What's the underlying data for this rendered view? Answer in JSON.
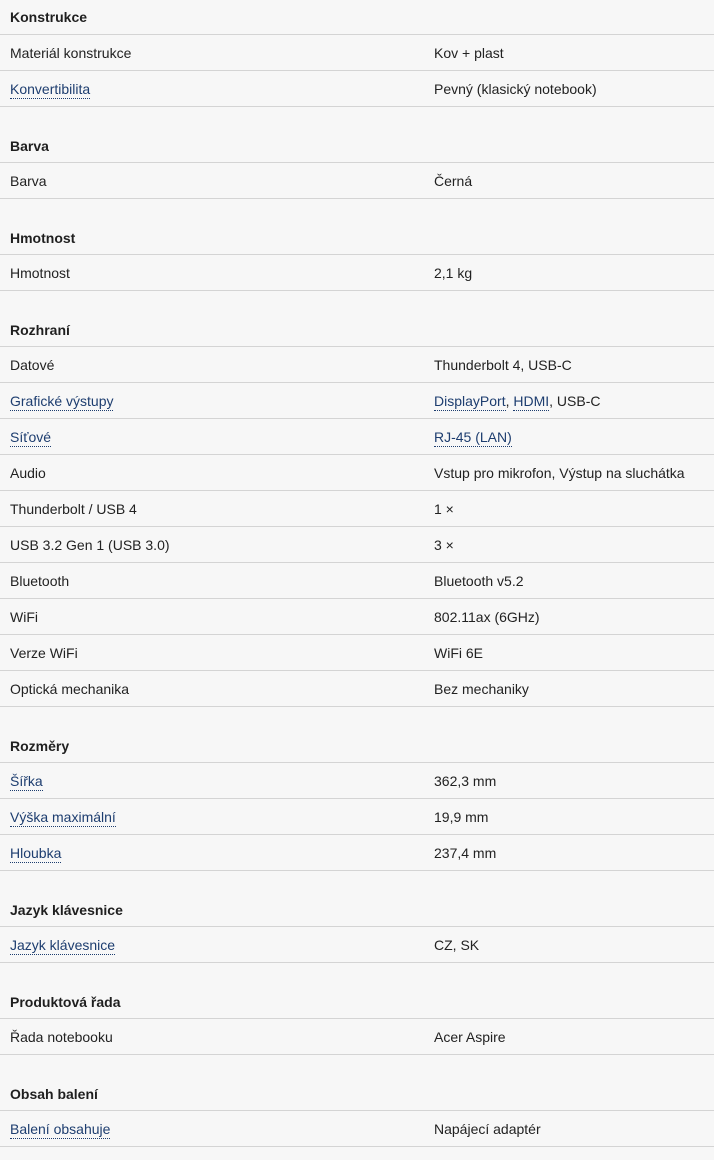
{
  "sections": [
    {
      "title": "Konstrukce",
      "rows": [
        {
          "label": "Materiál konstrukce",
          "label_link": false,
          "value": [
            {
              "text": "Kov + plast",
              "link": false
            }
          ]
        },
        {
          "label": "Konvertibilita",
          "label_link": true,
          "value": [
            {
              "text": "Pevný (klasický notebook)",
              "link": false
            }
          ]
        }
      ]
    },
    {
      "title": "Barva",
      "rows": [
        {
          "label": "Barva",
          "label_link": false,
          "value": [
            {
              "text": "Černá",
              "link": false
            }
          ]
        }
      ]
    },
    {
      "title": "Hmotnost",
      "rows": [
        {
          "label": "Hmotnost",
          "label_link": false,
          "value": [
            {
              "text": "2,1 kg",
              "link": false
            }
          ]
        }
      ]
    },
    {
      "title": "Rozhraní",
      "rows": [
        {
          "label": "Datové",
          "label_link": false,
          "value": [
            {
              "text": "Thunderbolt 4, USB-C",
              "link": false
            }
          ]
        },
        {
          "label": "Grafické výstupy",
          "label_link": true,
          "value": [
            {
              "text": "DisplayPort",
              "link": true
            },
            {
              "text": ", ",
              "link": false
            },
            {
              "text": "HDMI",
              "link": true
            },
            {
              "text": ", USB-C",
              "link": false
            }
          ]
        },
        {
          "label": "Síťové",
          "label_link": true,
          "value": [
            {
              "text": "RJ-45 (LAN)",
              "link": true
            }
          ]
        },
        {
          "label": "Audio",
          "label_link": false,
          "value": [
            {
              "text": "Vstup pro mikrofon, Výstup na sluchátka",
              "link": false
            }
          ]
        },
        {
          "label": "Thunderbolt / USB 4",
          "label_link": false,
          "value": [
            {
              "text": "1 ×",
              "link": false
            }
          ]
        },
        {
          "label": "USB 3.2 Gen 1 (USB 3.0)",
          "label_link": false,
          "value": [
            {
              "text": "3 ×",
              "link": false
            }
          ]
        },
        {
          "label": "Bluetooth",
          "label_link": false,
          "value": [
            {
              "text": "Bluetooth v5.2",
              "link": false
            }
          ]
        },
        {
          "label": "WiFi",
          "label_link": false,
          "value": [
            {
              "text": "802.11ax (6GHz)",
              "link": false
            }
          ]
        },
        {
          "label": "Verze WiFi",
          "label_link": false,
          "value": [
            {
              "text": "WiFi 6E",
              "link": false
            }
          ]
        },
        {
          "label": "Optická mechanika",
          "label_link": false,
          "value": [
            {
              "text": "Bez mechaniky",
              "link": false
            }
          ]
        }
      ]
    },
    {
      "title": "Rozměry",
      "rows": [
        {
          "label": "Šířka",
          "label_link": true,
          "value": [
            {
              "text": "362,3 mm",
              "link": false
            }
          ]
        },
        {
          "label": "Výška maximální",
          "label_link": true,
          "value": [
            {
              "text": "19,9 mm",
              "link": false
            }
          ]
        },
        {
          "label": "Hloubka",
          "label_link": true,
          "value": [
            {
              "text": "237,4 mm",
              "link": false
            }
          ]
        }
      ]
    },
    {
      "title": "Jazyk klávesnice",
      "rows": [
        {
          "label": "Jazyk klávesnice",
          "label_link": true,
          "value": [
            {
              "text": "CZ, SK",
              "link": false
            }
          ]
        }
      ]
    },
    {
      "title": "Produktová řada",
      "rows": [
        {
          "label": "Řada notebooku",
          "label_link": false,
          "value": [
            {
              "text": "Acer Aspire",
              "link": false
            }
          ]
        }
      ]
    },
    {
      "title": "Obsah balení",
      "rows": [
        {
          "label": "Balení obsahuje",
          "label_link": true,
          "value": [
            {
              "text": "Napájecí adaptér",
              "link": false
            }
          ]
        }
      ]
    }
  ]
}
